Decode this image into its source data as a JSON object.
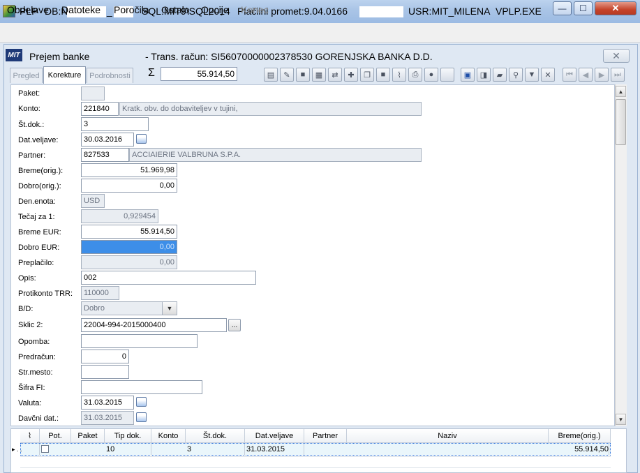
{
  "window": {
    "app": "PLP",
    "db_label": "DB:N",
    "db_suffix": "_",
    "sql": "SQL:MIT9\\SQL2014",
    "promet": "Plačilni promet:9.04.0166",
    "user": "USR:MIT_MILENA",
    "exe": "VPLP.EXE",
    "buttons": {
      "minimize": "—",
      "maximize": "☐",
      "close": "✕"
    }
  },
  "menu": [
    {
      "label": "Obdelave",
      "enabled": true
    },
    {
      "label": "Datoteke",
      "enabled": true
    },
    {
      "label": "Poročila",
      "enabled": true
    },
    {
      "label": "Ostalo",
      "enabled": true
    },
    {
      "label": "Opcije",
      "enabled": true
    },
    {
      "label": "Konec",
      "enabled": false
    }
  ],
  "child": {
    "logo": "MIT",
    "title": "Prejem banke",
    "subtitle": "- Trans. račun: SI56070000002378530  GORENJSKA BANKA D.D.",
    "close": "✕"
  },
  "tabs": [
    {
      "label": "Pregled",
      "active": false
    },
    {
      "label": "Korekture",
      "active": true
    },
    {
      "label": "Podrobnosti",
      "active": false
    }
  ],
  "toolbar": {
    "sigma": "Σ",
    "sum": "55.914,50",
    "icons": [
      "document-icon",
      "edit-icon",
      "blank-icon",
      "calc-icon",
      "transfer-icon",
      "puzzle-icon",
      "copy-icon",
      "table-icon",
      "attach-icon",
      "print-icon",
      "circle-icon",
      "empty-icon",
      "save-icon",
      "open-folder-icon",
      "folder-icon",
      "search-icon",
      "filter-icon",
      "clear-icon",
      "first-icon",
      "prev-icon",
      "next-icon",
      "last-icon"
    ]
  },
  "form": {
    "paket": {
      "label": "Paket:",
      "value": ""
    },
    "konto": {
      "label": "Konto:",
      "value": "221840",
      "desc": "Kratk. obv. do dobaviteljev v tujini,"
    },
    "stdok": {
      "label": "Št.dok.:",
      "value": "3"
    },
    "datveljave": {
      "label": "Dat.veljave:",
      "value": "30.03.2016"
    },
    "partner": {
      "label": "Partner:",
      "value": "827533",
      "desc": "ACCIAIERIE VALBRUNA S.P.A."
    },
    "bremeorig": {
      "label": "Breme(orig.):",
      "value": "51.969,98"
    },
    "dobroorig": {
      "label": "Dobro(orig.):",
      "value": "0,00"
    },
    "denenota": {
      "label": "Den.enota:",
      "value": "USD"
    },
    "tecaj": {
      "label": "Tečaj za 1:",
      "value": "0,929454"
    },
    "bremeeur": {
      "label": "Breme EUR:",
      "value": "55.914,50"
    },
    "dobroeur": {
      "label": "Dobro EUR:",
      "value": "0,00"
    },
    "preplacilo": {
      "label": "Preplačilo:",
      "value": "0,00"
    },
    "opis": {
      "label": "Opis:",
      "value": "002"
    },
    "protikonto": {
      "label": "Protikonto TRR:",
      "value": "110000"
    },
    "bd": {
      "label": "B/D:",
      "value": "Dobro"
    },
    "sklic": {
      "label": "Sklic 2:",
      "value": "22004-994-2015000400",
      "button": "..."
    },
    "opomba": {
      "label": "Opomba:",
      "value": ""
    },
    "predracun": {
      "label": "Predračun:",
      "value": "0"
    },
    "strmesto": {
      "label": "Str.mesto:",
      "value": ""
    },
    "sifrafi": {
      "label": "Šifra FI:",
      "value": ""
    },
    "valuta": {
      "label": "Valuta:",
      "value": "31.03.2015"
    },
    "davcnidat": {
      "label": "Davčni dat.:",
      "value": "31.03.2015"
    }
  },
  "grid": {
    "headers": [
      "Pot.",
      "Paket",
      "Tip dok.",
      "Konto",
      "Št.dok.",
      "Dat.veljave",
      "Partner",
      "Naziv",
      "Breme(orig.)"
    ],
    "row": {
      "marker": "▸ . .",
      "pot": "",
      "paket": "",
      "tipdok": "10",
      "konto": "",
      "stdok": "3",
      "datveljave": "31.03.2015",
      "partner": "",
      "naziv": "",
      "breme": "55.914,50"
    }
  }
}
